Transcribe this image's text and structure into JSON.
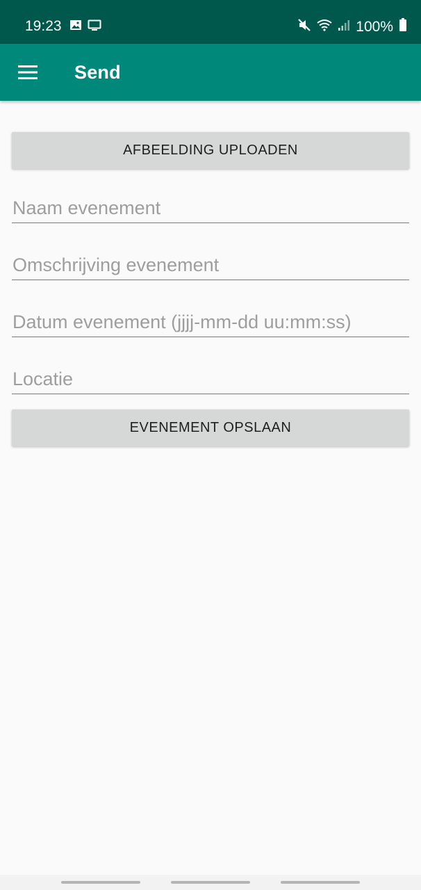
{
  "status_bar": {
    "time": "19:23",
    "battery_percent": "100%",
    "left_icons": [
      "image-icon",
      "monitor-icon"
    ],
    "right_icons": [
      "mute-icon",
      "wifi-icon",
      "signal-icon",
      "battery-icon"
    ]
  },
  "app_bar": {
    "title": "Send",
    "menu_icon": "hamburger-menu-icon"
  },
  "form": {
    "upload_button_label": "AFBEELDING UPLOADEN",
    "event_name_placeholder": "Naam evenement",
    "event_name_value": "",
    "description_placeholder": "Omschrijving evenement",
    "description_value": "",
    "date_placeholder": "Datum evenement (jjjj-mm-dd uu:mm:ss)",
    "date_value": "",
    "location_placeholder": "Locatie",
    "location_value": "",
    "save_button_label": "EVENEMENT OPSLAAN"
  },
  "colors": {
    "status_bar": "#00574b",
    "app_bar": "#00897b",
    "button_bg": "#d6d7d7",
    "background": "#fafafa"
  }
}
